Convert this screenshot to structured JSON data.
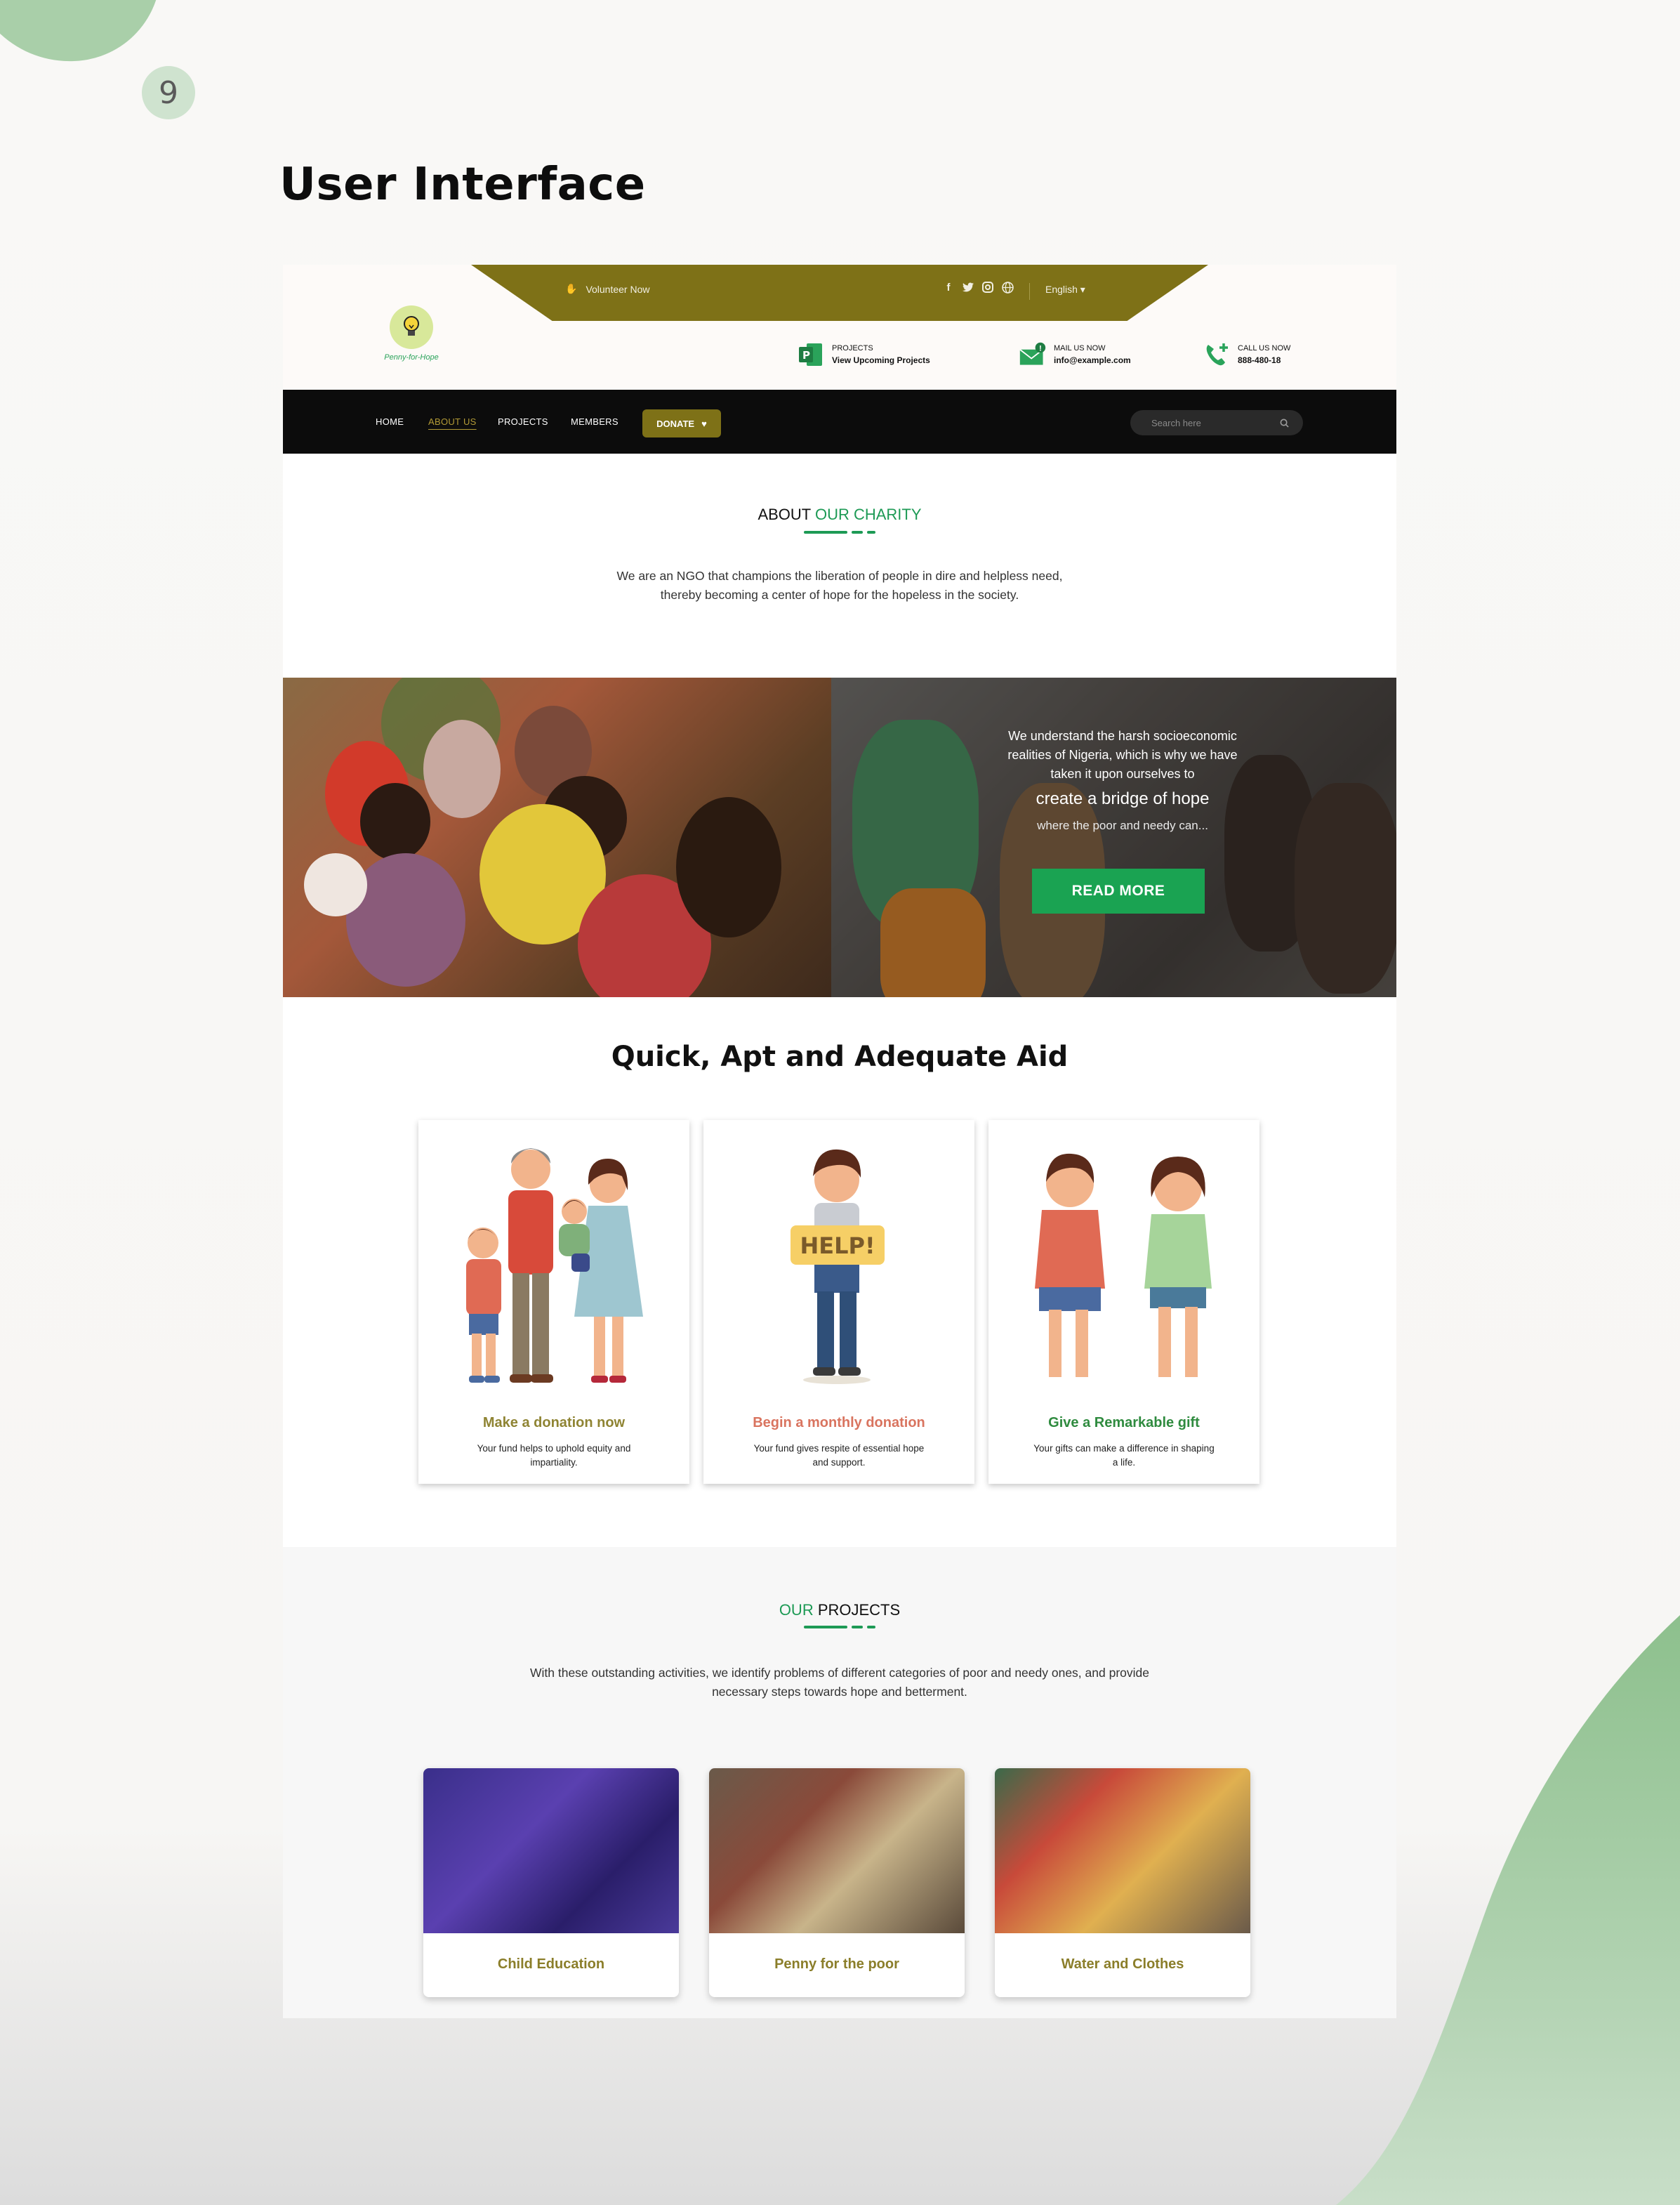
{
  "page": {
    "number": "9",
    "heading": "User Interface"
  },
  "topbar": {
    "volunteer": "Volunteer Now",
    "language": "English ▾",
    "logo_text": "Penny-for-Hope",
    "contacts": [
      {
        "label": "PROJECTS",
        "value": "View Upcoming Projects"
      },
      {
        "label": "MAIL US NOW",
        "value": "info@example.com"
      },
      {
        "label": "CALL US NOW",
        "value": "888-480-18"
      }
    ]
  },
  "nav": {
    "items": [
      "HOME",
      "ABOUT US",
      "PROJECTS",
      "MEMBERS"
    ],
    "active": "ABOUT US",
    "donate": "DONATE",
    "search_placeholder": "Search here"
  },
  "about": {
    "title_a": "ABOUT ",
    "title_b": "OUR CHARITY",
    "line1": "We are an NGO that champions the liberation of people in dire and helpless need,",
    "line2": "thereby becoming a center of hope for the hopeless in the society."
  },
  "hero": {
    "p1": "We understand the harsh socioeconomic realities of Nigeria, which is why we have taken it upon ourselves to",
    "p2": "create a bridge of hope",
    "p3": "where the poor and needy can...",
    "button": "READ MORE"
  },
  "aid": {
    "title": "Quick, Apt and Adequate Aid",
    "cards": [
      {
        "title": "Make a donation now",
        "desc": "Your fund helps to uphold equity and impartiality.",
        "color": "#8f8433"
      },
      {
        "title": "Begin a monthly donation",
        "desc": "Your fund gives respite of essential hope and support.",
        "color": "#d9745f"
      },
      {
        "title": "Give a Remarkable gift",
        "desc": "Your gifts can make a difference in shaping a life.",
        "color": "#2f8b3f"
      }
    ],
    "help_sign": "HELP!"
  },
  "projects": {
    "title_a": "OUR ",
    "title_b": "PROJECTS",
    "line1": "With these outstanding activities, we identify problems of different categories of poor and needy ones, and provide",
    "line2": "necessary steps towards hope and betterment.",
    "cards": [
      "Child Education",
      "Penny for the poor",
      "Water and Clothes"
    ]
  },
  "colors": {
    "olive": "#7e7117",
    "green": "#1d9a55",
    "nav": "#0c0c0c"
  }
}
